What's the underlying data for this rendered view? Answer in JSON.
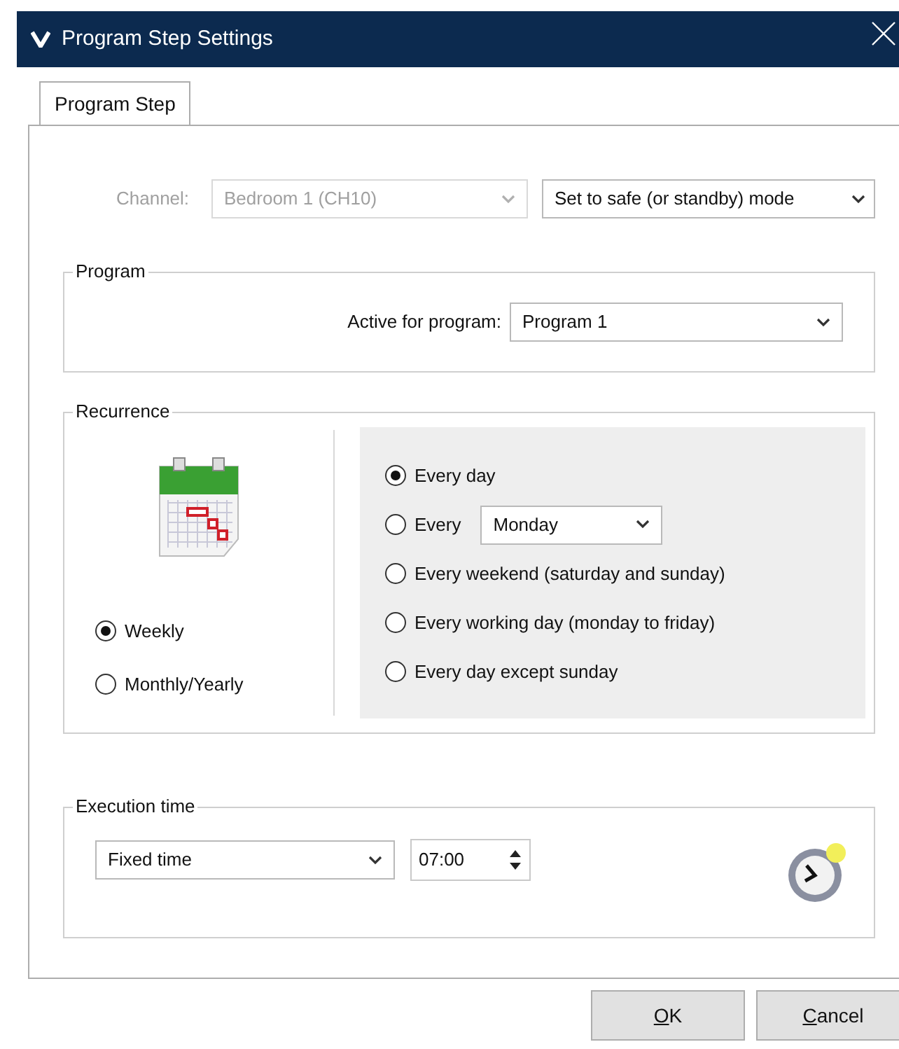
{
  "window": {
    "title": "Program Step Settings"
  },
  "tabs": [
    {
      "label": "Program Step",
      "selected": true
    }
  ],
  "channel": {
    "label": "Channel:",
    "value": "Bedroom 1 (CH10)",
    "disabled": true,
    "action": "Set to safe (or standby) mode"
  },
  "program": {
    "title": "Program",
    "label": "Active for program:",
    "value": "Program 1"
  },
  "recurrence": {
    "title": "Recurrence",
    "modes": [
      {
        "label": "Weekly",
        "selected": true
      },
      {
        "label": "Monthly/Yearly",
        "selected": false
      }
    ],
    "options": [
      {
        "kind": "plain",
        "label": "Every day",
        "selected": true
      },
      {
        "kind": "day",
        "label": "Every",
        "day": "Monday",
        "selected": false
      },
      {
        "kind": "plain",
        "label": "Every weekend (saturday and sunday)",
        "selected": false
      },
      {
        "kind": "plain",
        "label": "Every working day (monday to friday)",
        "selected": false
      },
      {
        "kind": "plain",
        "label": "Every day except sunday",
        "selected": false
      }
    ]
  },
  "execution": {
    "title": "Execution time",
    "mode": "Fixed time",
    "time": "07:00"
  },
  "buttons": [
    "OK",
    "Cancel"
  ]
}
